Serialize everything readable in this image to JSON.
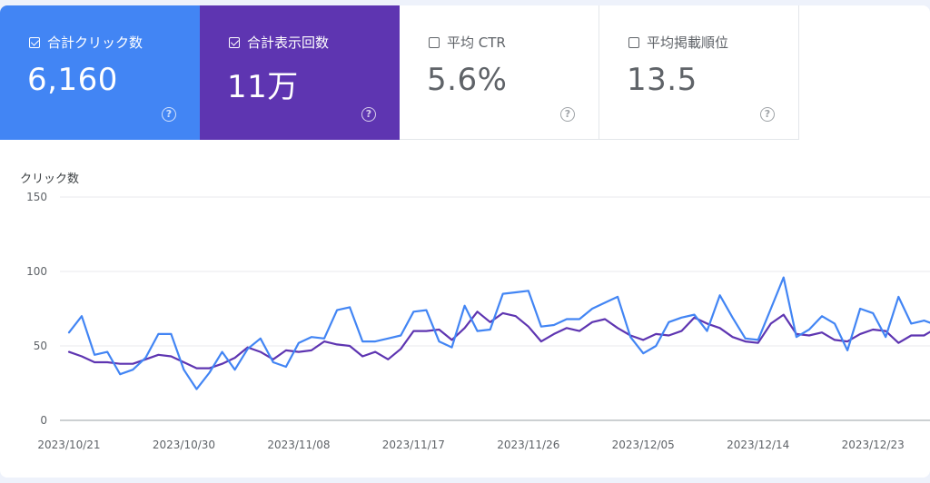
{
  "metrics": [
    {
      "label": "合計クリック数",
      "value": "6,160",
      "checked": true,
      "help": "?"
    },
    {
      "label": "合計表示回数",
      "value": "11万",
      "checked": true,
      "help": "?"
    },
    {
      "label": "平均 CTR",
      "value": "5.6%",
      "checked": false,
      "help": "?"
    },
    {
      "label": "平均掲載順位",
      "value": "13.5",
      "checked": false,
      "help": "?"
    }
  ],
  "colors": {
    "clicks": "#4285f4",
    "impressions": "#5e35b1",
    "grid": "#e8eaed",
    "axis": "#9aa0a6"
  },
  "chart_data": {
    "type": "line",
    "ylabel": "クリック数",
    "ylim": [
      0,
      150
    ],
    "yticks": [
      0,
      50,
      100,
      150
    ],
    "xticks": [
      {
        "index": 0,
        "label": "2023/10/21"
      },
      {
        "index": 9,
        "label": "2023/10/30"
      },
      {
        "index": 18,
        "label": "2023/11/08"
      },
      {
        "index": 27,
        "label": "2023/11/17"
      },
      {
        "index": 36,
        "label": "2023/11/26"
      },
      {
        "index": 45,
        "label": "2023/12/05"
      },
      {
        "index": 54,
        "label": "2023/12/14"
      },
      {
        "index": 63,
        "label": "2023/12/23"
      }
    ],
    "series": [
      {
        "key": "clicks",
        "values": [
          59,
          70,
          44,
          46,
          31,
          34,
          42,
          58,
          58,
          34,
          21,
          32,
          46,
          34,
          48,
          55,
          39,
          36,
          52,
          56,
          55,
          74,
          76,
          53,
          53,
          55,
          57,
          73,
          74,
          53,
          49,
          77,
          60,
          61,
          85,
          86,
          87,
          63,
          64,
          68,
          68,
          75,
          79,
          83,
          56,
          45,
          50,
          66,
          69,
          71,
          60,
          84,
          69,
          55,
          54,
          75,
          96,
          56,
          61,
          70,
          65,
          47,
          75,
          72,
          56,
          83,
          65,
          67,
          64
        ],
        "color": "#4285f4"
      },
      {
        "key": "impressions",
        "values": [
          46,
          43,
          39,
          39,
          38,
          38,
          41,
          44,
          43,
          39,
          35,
          35,
          38,
          42,
          49,
          46,
          41,
          47,
          46,
          47,
          53,
          51,
          50,
          43,
          46,
          41,
          48,
          60,
          60,
          61,
          54,
          62,
          73,
          66,
          72,
          70,
          63,
          53,
          58,
          62,
          60,
          66,
          68,
          62,
          57,
          54,
          58,
          57,
          60,
          69,
          65,
          62,
          56,
          53,
          52,
          65,
          71,
          58,
          57,
          59,
          54,
          53,
          58,
          61,
          60,
          52,
          57,
          57,
          62
        ],
        "color": "#5e35b1"
      }
    ]
  }
}
